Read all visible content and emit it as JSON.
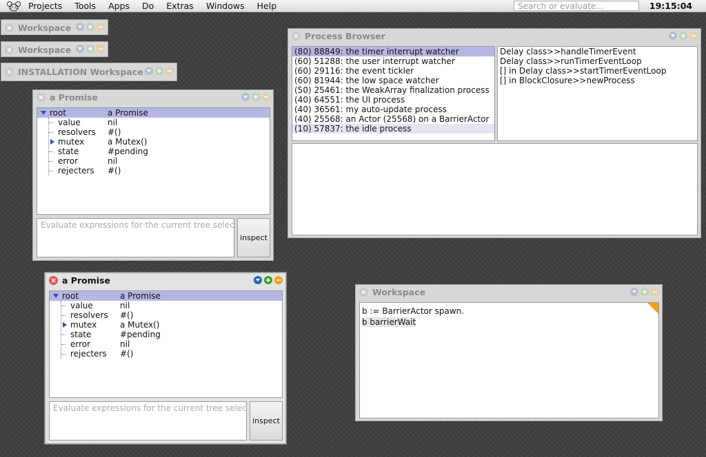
{
  "menubar": {
    "items": [
      "Projects",
      "Tools",
      "Apps",
      "Do",
      "Extras",
      "Windows",
      "Help"
    ],
    "search_placeholder": "Search or evaluate...",
    "clock": "19:15:04"
  },
  "collapsed_windows": [
    {
      "title": "Workspace"
    },
    {
      "title": "Workspace"
    },
    {
      "title": "INSTALLATION Workspace"
    }
  ],
  "inspector1": {
    "title": "a Promise",
    "rows": [
      {
        "key": "root",
        "value": "a Promise"
      },
      {
        "key": "value",
        "value": "nil"
      },
      {
        "key": "resolvers",
        "value": "#()"
      },
      {
        "key": "mutex",
        "value": "a Mutex()"
      },
      {
        "key": "state",
        "value": "#pending"
      },
      {
        "key": "error",
        "value": "nil"
      },
      {
        "key": "rejecters",
        "value": "#()"
      }
    ],
    "eval_placeholder": "Evaluate expressions for the current tree selection...",
    "inspect_label": "inspect"
  },
  "inspector2": {
    "title": "a Promise",
    "rows": [
      {
        "key": "root",
        "value": "a Promise"
      },
      {
        "key": "value",
        "value": "nil"
      },
      {
        "key": "resolvers",
        "value": "#()"
      },
      {
        "key": "mutex",
        "value": "a Mutex()"
      },
      {
        "key": "state",
        "value": "#pending"
      },
      {
        "key": "error",
        "value": "nil"
      },
      {
        "key": "rejecters",
        "value": "#()"
      }
    ],
    "eval_placeholder": "Evaluate expressions for the current tree selection...",
    "inspect_label": "inspect"
  },
  "process_browser": {
    "title": "Process Browser",
    "processes": [
      "(80) 88849: the timer interrupt watcher",
      "(60) 51288: the user interrupt watcher",
      "(60) 29116: the event tickler",
      "(60) 81944: the low space watcher",
      "(50) 25461: the WeakArray finalization process",
      "(40) 64551: the UI process",
      "(40) 36561: my auto-update process",
      "(40) 25568: an Actor (25568) on a BarrierActor",
      "(10) 57837: the idle process"
    ],
    "stack": [
      "Delay class>>handleTimerEvent",
      "Delay class>>runTimerEventLoop",
      "[] in Delay class>>startTimerEventLoop",
      "[] in BlockClosure>>newProcess"
    ]
  },
  "workspace": {
    "title": "Workspace",
    "lines": [
      "b := BarrierActor spawn.",
      "b barrierWait"
    ]
  }
}
